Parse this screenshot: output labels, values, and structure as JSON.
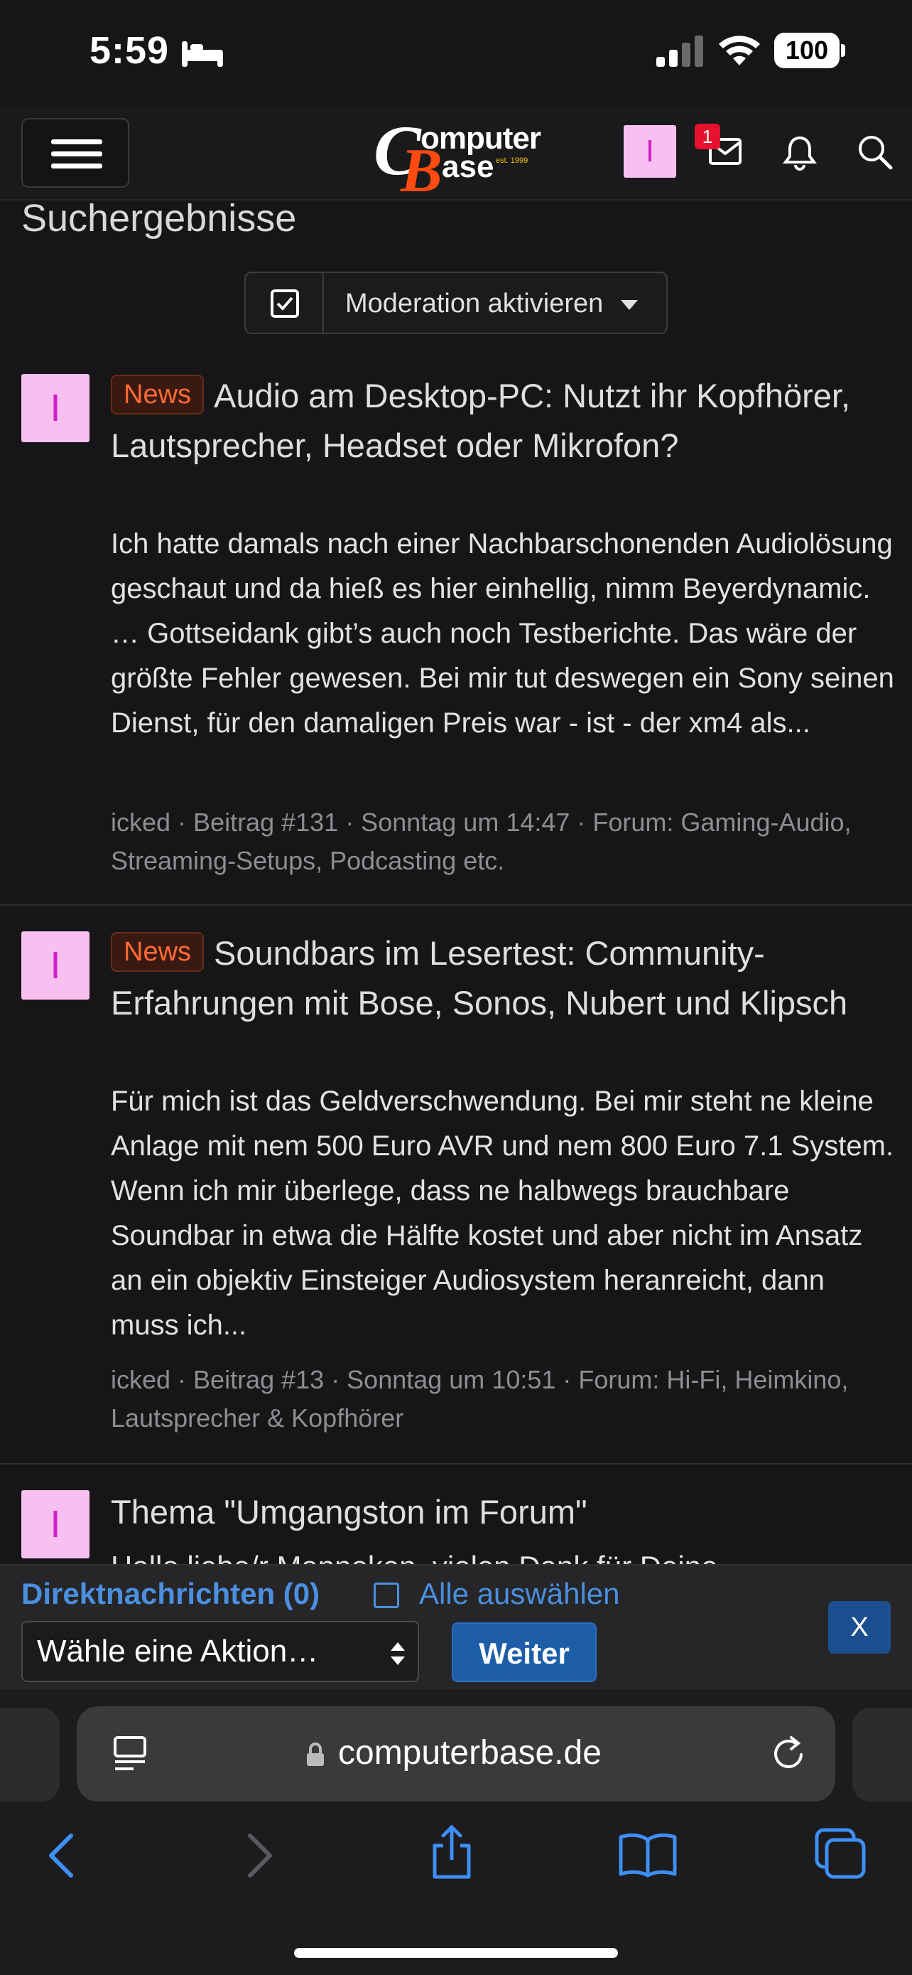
{
  "status_bar": {
    "time": "5:59",
    "battery": "100"
  },
  "header": {
    "avatar_letter": "I",
    "inbox_count": "1"
  },
  "logo": {
    "letter_c": "C",
    "letter_b": "B",
    "omputer": "omputer",
    "ase": "ase",
    "est": "est. 1999"
  },
  "page": {
    "title": "Suchergebnisse",
    "moderation_label": "Moderation aktivieren"
  },
  "results": [
    {
      "avatar_letter": "I",
      "badge": "News",
      "title": "Audio am Desktop-PC: Nutzt ihr Kopfhörer, Lautsprecher, Headset oder Mikrofon?",
      "snippet": "Ich hatte damals nach einer Nachbarschonenden Audiolösung geschaut und da hieß es hier einhellig, nimm Beyerdynamic. … Gottseidank gibt’s auch noch Testberichte. Das wäre der größte Fehler gewesen. Bei mir tut deswegen ein Sony seinen Dienst, für den damaligen Preis war - ist - der xm4 als...",
      "meta": "icked · Beitrag #131 · Sonntag um 14:47 · Forum: Gaming-Audio, Streaming-Setups, Podcasting etc."
    },
    {
      "avatar_letter": "I",
      "badge": "News",
      "title": "Soundbars im Lesertest: Community-Erfahrungen mit Bose, Sonos, Nubert und Klipsch",
      "snippet": "Für mich ist das Geldverschwendung. Bei mir steht ne kleine Anlage mit nem 500 Euro AVR und nem 800 Euro 7.1 System. Wenn ich mir überlege, dass ne halbwegs brauchbare Soundbar in etwa die Hälfte kostet und aber nicht im Ansatz an ein objektiv Einsteiger Audiosystem heranreicht, dann muss ich...",
      "meta": "icked · Beitrag #13 · Sonntag um 10:51 · Forum: Hi-Fi, Heimkino, Lautsprecher & Kopfhörer"
    },
    {
      "avatar_letter": "I",
      "title": "Thema \"Umgangston im Forum\"",
      "snippet": "Hallo liebe/r Mannoken, vielen Dank für Deine"
    }
  ],
  "action_bar": {
    "dm_label": "Direktnachrichten (0)",
    "select_all": "Alle auswählen",
    "action_select": "Wähle eine Aktion…",
    "weiter": "Weiter",
    "close": "X"
  },
  "browser": {
    "url": "computerbase.de"
  },
  "colors": {
    "accent": "#4a8fe0",
    "news_badge": "#ff6a35",
    "avatar_bg": "#f8c0f0",
    "avatar_fg": "#d01fc6",
    "weiter_bg": "#1e5ea8"
  }
}
